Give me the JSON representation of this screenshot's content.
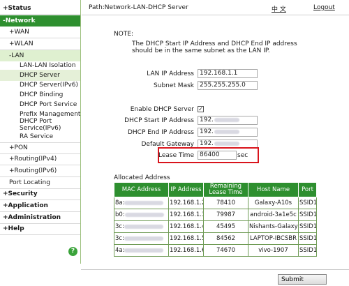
{
  "sidebar": {
    "status": "+Status",
    "network": "-Network",
    "wan": "+WAN",
    "wlan": "+WLAN",
    "lan": "-LAN",
    "lan_items": [
      "LAN-LAN Isolation",
      "DHCP Server",
      "DHCP Server(IPv6)",
      "DHCP Binding",
      "DHCP Port Service",
      "Prefix Management",
      "DHCP Port Service(IPv6)",
      "RA Service"
    ],
    "pon": "+PON",
    "routing_ipv4": "+Routing(IPv4)",
    "routing_ipv6": "+Routing(IPv6)",
    "port_locating": "Port Locating",
    "security": "+Security",
    "application": "+Application",
    "administration": "+Administration",
    "help": "+Help",
    "help_badge": "?"
  },
  "header": {
    "path": "Path:Network-LAN-DHCP Server",
    "lang": "中 文",
    "logout": "Logout"
  },
  "note": {
    "label": "NOTE:",
    "text": "The DHCP Start IP Address and DHCP End IP address should be in the same subnet as the LAN IP."
  },
  "form": {
    "lan_ip_label": "LAN IP Address",
    "lan_ip_value": "192.168.1.1",
    "subnet_label": "Subnet Mask",
    "subnet_value": "255.255.255.0",
    "enable_label": "Enable DHCP Server",
    "enable_check": "✓",
    "start_label": "DHCP Start IP Address",
    "start_value": "192.",
    "end_label": "DHCP End IP Address",
    "end_value": "192.",
    "gateway_label": "Default Gateway",
    "gateway_value": "192.",
    "lease_label": "Lease Time",
    "lease_value": "86400",
    "lease_unit": "sec"
  },
  "allocated": {
    "title": "Allocated Address",
    "headers": [
      "MAC Address",
      "IP Address",
      "Remaining Lease Time",
      "Host Name",
      "Port"
    ],
    "rows": [
      {
        "mac": "8a:",
        "ip": "192.168.1.2",
        "lease": "78410",
        "host": "Galaxy-A10s",
        "port": "SSID1"
      },
      {
        "mac": "b0:",
        "ip": "192.168.1.3",
        "lease": "79987",
        "host": "android-3a1e5c",
        "port": "SSID1"
      },
      {
        "mac": "3c:",
        "ip": "192.168.1.4",
        "lease": "45495",
        "host": "Nishants-Galaxy",
        "port": "SSID1"
      },
      {
        "mac": "3c:",
        "ip": "192.168.1.5",
        "lease": "84562",
        "host": "LAPTOP-IBCSBR",
        "port": "SSID1"
      },
      {
        "mac": "4a:",
        "ip": "192.168.1.6",
        "lease": "74670",
        "host": "vivo-1907",
        "port": "SSID1"
      }
    ]
  },
  "footer": {
    "submit": "Submit"
  }
}
